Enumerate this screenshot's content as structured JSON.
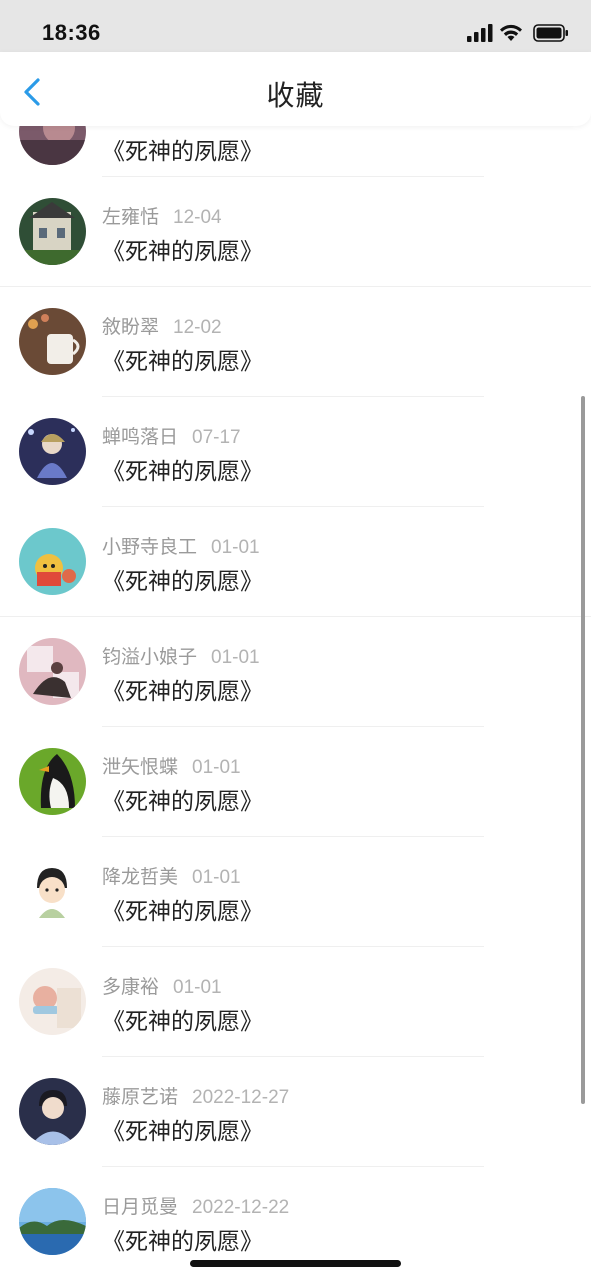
{
  "status_bar": {
    "time": "18:36"
  },
  "header": {
    "title": "收藏"
  },
  "items": [
    {
      "name": "",
      "date": "",
      "title": "《死神的夙愿》",
      "avatar_color": "#7b5a6a"
    },
    {
      "name": "左雍恬",
      "date": "12-04",
      "title": "《死神的夙愿》",
      "avatar_color": "#3c5a3a"
    },
    {
      "name": "敘盼翠",
      "date": "12-02",
      "title": "《死神的夙愿》",
      "avatar_color": "#8a5a3c"
    },
    {
      "name": "蝉鸣落日",
      "date": "07-17",
      "title": "《死神的夙愿》",
      "avatar_color": "#3a3e6a"
    },
    {
      "name": "小野寺良工",
      "date": "01-01",
      "title": "《死神的夙愿》",
      "avatar_color": "#5fc3c8"
    },
    {
      "name": "钧溢小娘子",
      "date": "01-01",
      "title": "《死神的夙愿》",
      "avatar_color": "#d8a8b0"
    },
    {
      "name": "泄矢恨蝶",
      "date": "01-01",
      "title": "《死神的夙愿》",
      "avatar_color": "#6aa82a"
    },
    {
      "name": "降龙哲美",
      "date": "01-01",
      "title": "《死神的夙愿》",
      "avatar_color": "#ffffff"
    },
    {
      "name": "多康裕",
      "date": "01-01",
      "title": "《死神的夙愿》",
      "avatar_color": "#e8d8d0"
    },
    {
      "name": "藤原艺诺",
      "date": "2022-12-27",
      "title": "《死神的夙愿》",
      "avatar_color": "#4a5a8a"
    },
    {
      "name": "日月觅曼",
      "date": "2022-12-22",
      "title": "《死神的夙愿》",
      "avatar_color": "#4a8ac8"
    }
  ],
  "colors": {
    "accent": "#2b9be8",
    "title_text": "#222222",
    "meta_text": "#9a9a9a"
  }
}
